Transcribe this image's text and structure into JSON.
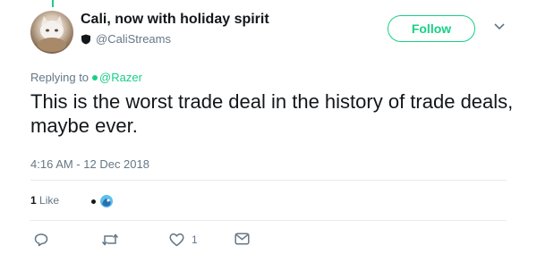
{
  "tweet": {
    "display_name": "Cali, now with holiday spirit",
    "handle": "@CaliStreams",
    "follow_label": "Follow",
    "replying_prefix": "Replying to",
    "replying_to": "@Razer",
    "text": "This is the worst trade deal in the history of trade deals, maybe ever.",
    "timestamp": "4:16 AM - 12 Dec 2018",
    "likes_count": "1",
    "likes_label": "Like",
    "actions": {
      "reply_count": "",
      "retweet_count": "",
      "like_count": "1"
    }
  },
  "colors": {
    "accent": "#19cf86",
    "text_primary": "#14171a",
    "text_secondary": "#657786",
    "divider": "#e6ecf0"
  },
  "icons": {
    "handle_badge": "shield-icon",
    "menu": "chevron-down-icon",
    "reply": "speech-bubble-icon",
    "retweet": "retweet-icon",
    "like": "heart-icon",
    "direct_message": "envelope-icon"
  }
}
